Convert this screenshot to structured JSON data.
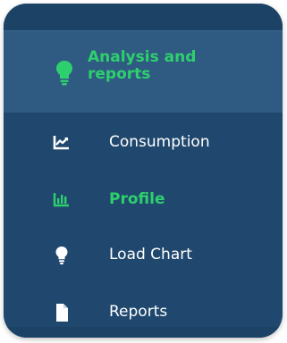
{
  "sidebar": {
    "section": {
      "title": "Analysis and reports",
      "icon": "lightbulb-icon",
      "color": "#2ed06e"
    },
    "items": [
      {
        "label": "Consumption",
        "icon": "line-chart-icon",
        "active": false
      },
      {
        "label": "Profile",
        "icon": "bar-chart-icon",
        "active": true
      },
      {
        "label": "Load Chart",
        "icon": "lightbulb-icon",
        "active": false
      },
      {
        "label": "Reports",
        "icon": "document-icon",
        "active": false
      }
    ],
    "colors": {
      "background": "#20486e",
      "section_background": "#2f5a81",
      "text": "#ffffff",
      "accent": "#2ed06e"
    }
  }
}
